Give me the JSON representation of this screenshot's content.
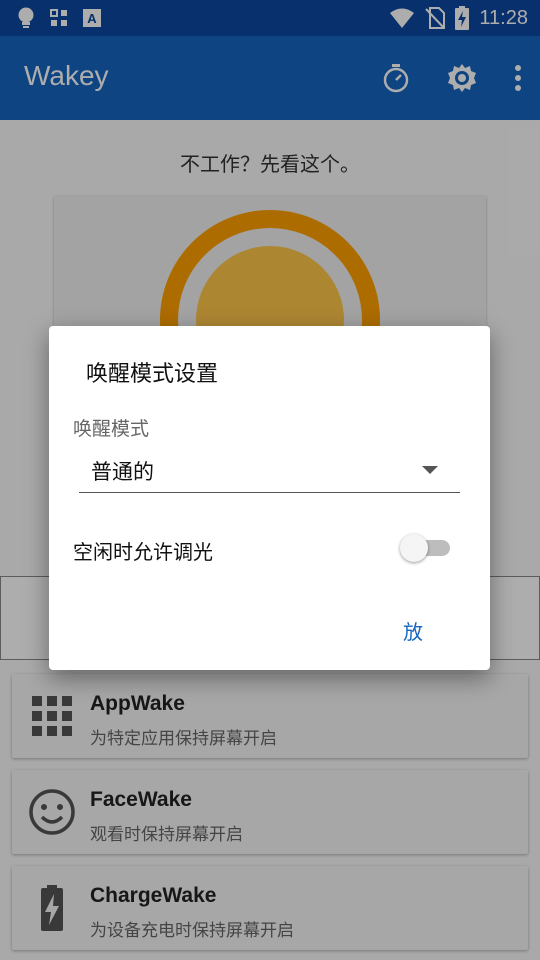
{
  "status_bar": {
    "time": "11:28",
    "left_icons": [
      "bulb-icon",
      "grid-icon",
      "a-box-icon"
    ],
    "right_icons": [
      "wifi-icon",
      "no-sim-icon",
      "battery-charging-icon"
    ]
  },
  "app_bar": {
    "title": "Wakey",
    "actions": [
      "timer-icon",
      "settings-icon",
      "more-vert-icon"
    ]
  },
  "main": {
    "hint": "不工作？先看这个。",
    "cards": [
      {
        "name": "AppWake",
        "desc": "为特定应用保持屏幕开启",
        "icon": "apps-grid-icon"
      },
      {
        "name": "FaceWake",
        "desc": "观看时保持屏幕开启",
        "icon": "face-icon"
      },
      {
        "name": "ChargeWake",
        "desc": "为设备充电时保持屏幕开启",
        "icon": "battery-charge-icon"
      }
    ]
  },
  "dialog": {
    "title": "唤醒模式设置",
    "mode_label": "唤醒模式",
    "mode_value": "普通的",
    "dim_label": "空闲时允许调光",
    "dim_enabled": false,
    "button": "放"
  },
  "colors": {
    "status_bar": "#0d47a1",
    "app_bar": "#1565c0",
    "accent": "#1565c0",
    "sun_ring": "#ffa000",
    "sun_core": "#ffc64a"
  }
}
